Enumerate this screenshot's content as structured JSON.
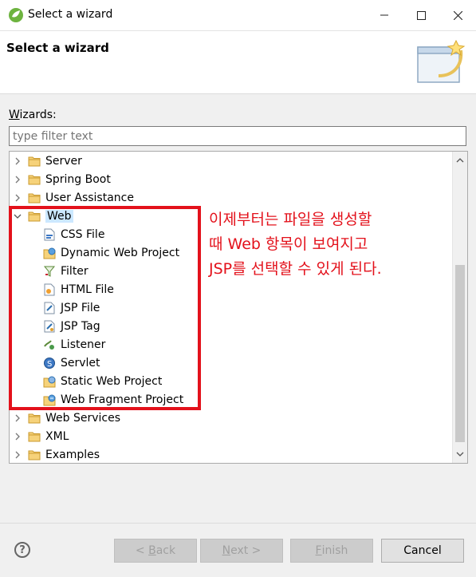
{
  "window": {
    "title": "Select a wizard"
  },
  "header": {
    "title": "Select a wizard"
  },
  "wizards": {
    "label_prefix": "W",
    "label_rest": "izards:",
    "filter_placeholder": "type filter text"
  },
  "tree": {
    "items": [
      {
        "label": "Server",
        "level": 0,
        "expanded": false,
        "icon": "folder-icon"
      },
      {
        "label": "Spring Boot",
        "level": 0,
        "expanded": false,
        "icon": "folder-icon"
      },
      {
        "label": "User Assistance",
        "level": 0,
        "expanded": false,
        "icon": "folder-icon"
      },
      {
        "label": "Web",
        "level": 0,
        "expanded": true,
        "icon": "folder-icon",
        "selected": true
      },
      {
        "label": "CSS File",
        "level": 1,
        "icon": "css-file-icon"
      },
      {
        "label": "Dynamic Web Project",
        "level": 1,
        "icon": "web-project-icon"
      },
      {
        "label": "Filter",
        "level": 1,
        "icon": "filter-icon"
      },
      {
        "label": "HTML File",
        "level": 1,
        "icon": "html-file-icon"
      },
      {
        "label": "JSP File",
        "level": 1,
        "icon": "jsp-file-icon"
      },
      {
        "label": "JSP Tag",
        "level": 1,
        "icon": "jsp-tag-icon"
      },
      {
        "label": "Listener",
        "level": 1,
        "icon": "listener-icon"
      },
      {
        "label": "Servlet",
        "level": 1,
        "icon": "servlet-icon"
      },
      {
        "label": "Static Web Project",
        "level": 1,
        "icon": "static-web-project-icon"
      },
      {
        "label": "Web Fragment Project",
        "level": 1,
        "icon": "web-fragment-project-icon"
      },
      {
        "label": "Web Services",
        "level": 0,
        "expanded": false,
        "icon": "folder-icon"
      },
      {
        "label": "XML",
        "level": 0,
        "expanded": false,
        "icon": "folder-icon"
      },
      {
        "label": "Examples",
        "level": 0,
        "expanded": false,
        "icon": "folder-icon"
      }
    ]
  },
  "annotation": {
    "lines": [
      "이제부터는 파일을 생성할",
      "때 Web 항목이 보여지고",
      "JSP를 선택할 수 있게 된다."
    ],
    "color": "#e3111b"
  },
  "buttons": {
    "help": "?",
    "back_prefix": "< ",
    "back_mn": "B",
    "back_rest": "ack",
    "next_mn": "N",
    "next_rest": "ext >",
    "finish_mn": "F",
    "finish_rest": "inish",
    "cancel": "Cancel"
  }
}
